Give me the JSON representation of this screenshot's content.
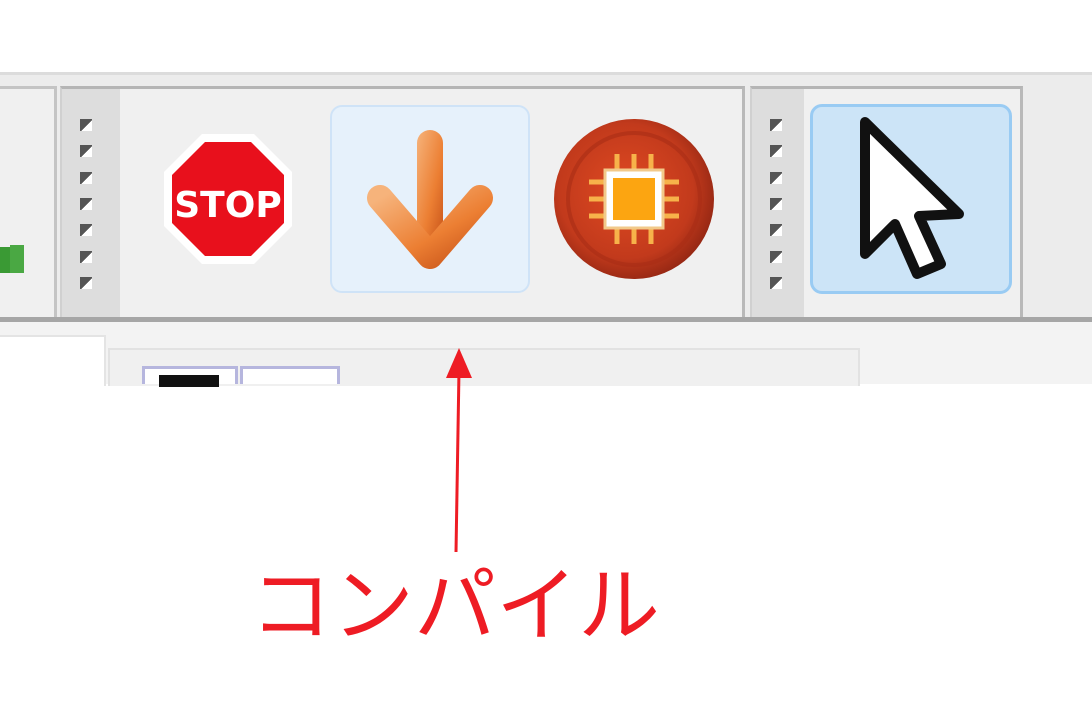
{
  "toolbar": {
    "stop_button": {
      "icon": "stop-sign-icon",
      "label": "STOP",
      "color": "#e8101c"
    },
    "compile_button": {
      "icon": "down-arrow-icon",
      "color": "#ef8a3a"
    },
    "upload_button": {
      "icon": "chip-icon",
      "color": "#c0391b"
    },
    "select_tool": {
      "icon": "cursor-arrow-icon",
      "active": true
    }
  },
  "annotation": {
    "text": "コンパイル",
    "color": "#ee1c24"
  }
}
